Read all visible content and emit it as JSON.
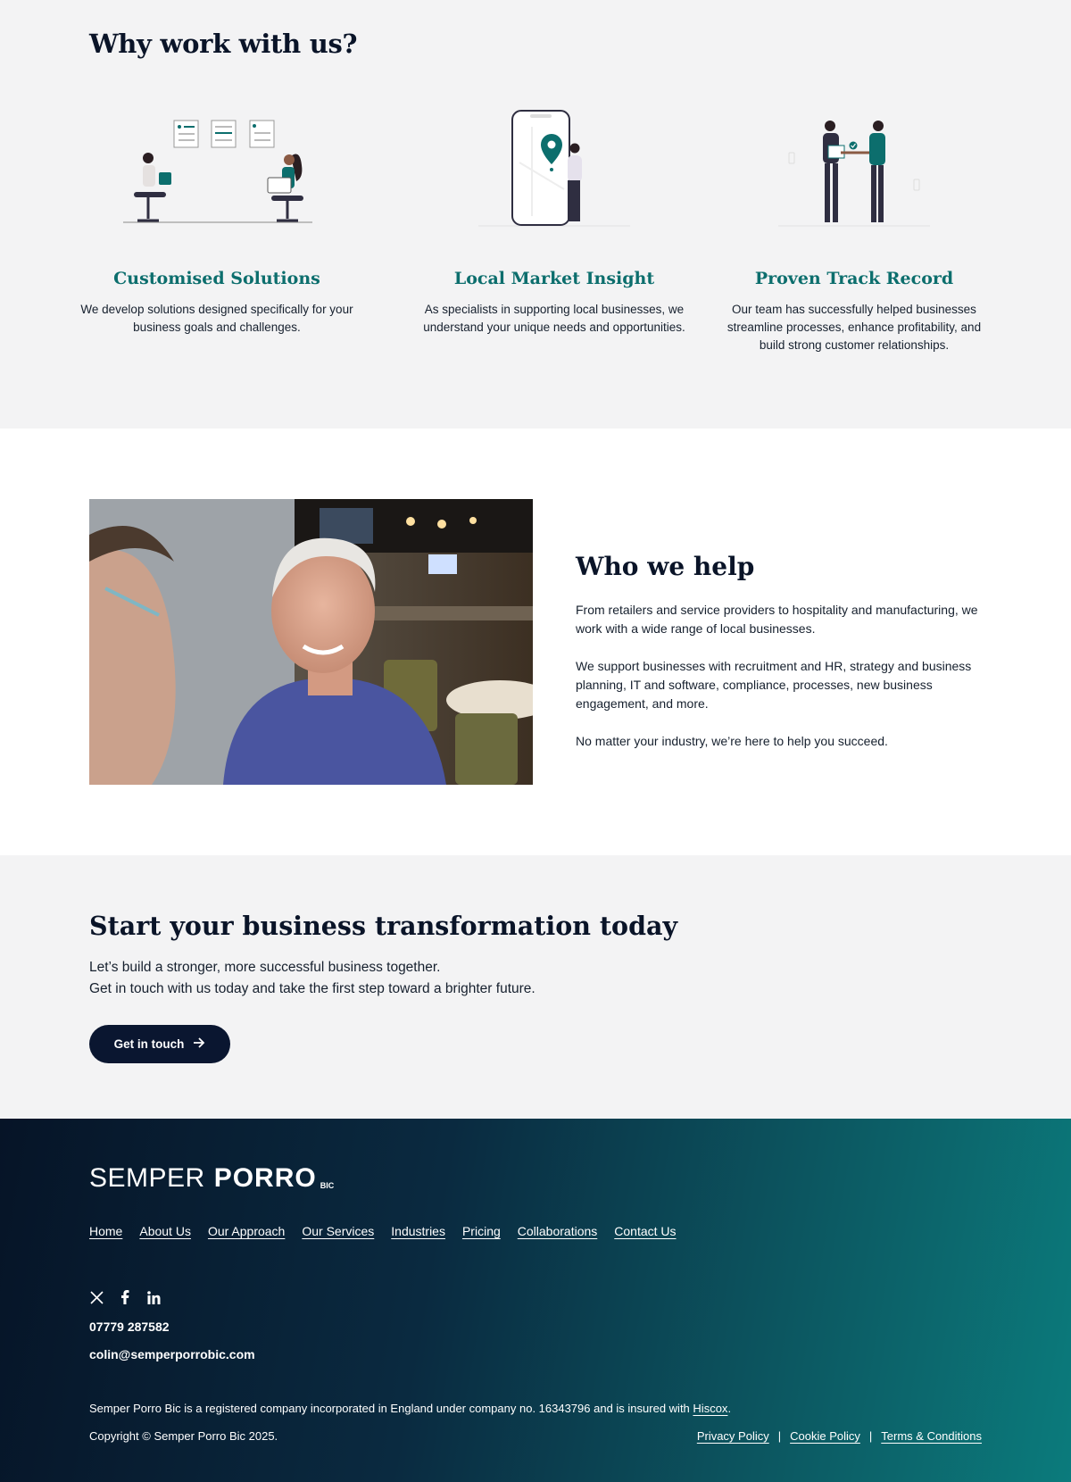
{
  "why": {
    "title": "Why work with us?",
    "features": [
      {
        "title": "Customised Solutions",
        "text": "We develop solutions designed specifically for your business goals and challenges.",
        "illustration": "team-workspace-illustration"
      },
      {
        "title": "Local Market Insight",
        "text": "As specialists in supporting local businesses, we understand your unique needs and opportunities.",
        "illustration": "phone-location-illustration"
      },
      {
        "title": "Proven Track Record",
        "text": "Our team has successfully helped businesses streamline processes, enhance profitability, and build strong customer relationships.",
        "illustration": "handshake-illustration"
      }
    ]
  },
  "who": {
    "title": "Who we help",
    "paragraphs": [
      "From retailers and service providers to hospitality and manufacturing, we work with a wide range of local businesses.",
      "We support businesses with recruitment and HR, strategy and business planning, IT and software, compliance, processes, new business engagement, and more.",
      "No matter your industry, we’re here to help you succeed."
    ]
  },
  "cta": {
    "title": "Start your business transformation today",
    "line1": "Let’s build a stronger, more successful business together.",
    "line2": "Get in touch with us today and take the first step toward a brighter future.",
    "button": "Get in touch"
  },
  "footer": {
    "logo": {
      "part1": "SEMPER",
      "part2": "PORRO",
      "part3": "BIC"
    },
    "nav": [
      "Home",
      "About Us",
      "Our Approach",
      "Our Services",
      "Industries",
      "Pricing",
      "Collaborations",
      "Contact Us"
    ],
    "social": [
      "x-icon",
      "facebook-icon",
      "linkedin-icon"
    ],
    "phone": "07779 287582",
    "email": "colin@semperporrobic.com",
    "legal_text": "Semper Porro Bic is a registered company incorporated in England under company no. 16343796 and is insured with",
    "legal_link": "Hiscox",
    "copyright": "Copyright © Semper Porro Bic 2025.",
    "policies": [
      "Privacy Policy",
      "Cookie Policy",
      "Terms & Conditions"
    ],
    "separator": "|"
  },
  "colors": {
    "accent": "#0c6e6d",
    "navy": "#0a1630",
    "footer_start": "#061427",
    "footer_end": "#0b7b7c"
  }
}
